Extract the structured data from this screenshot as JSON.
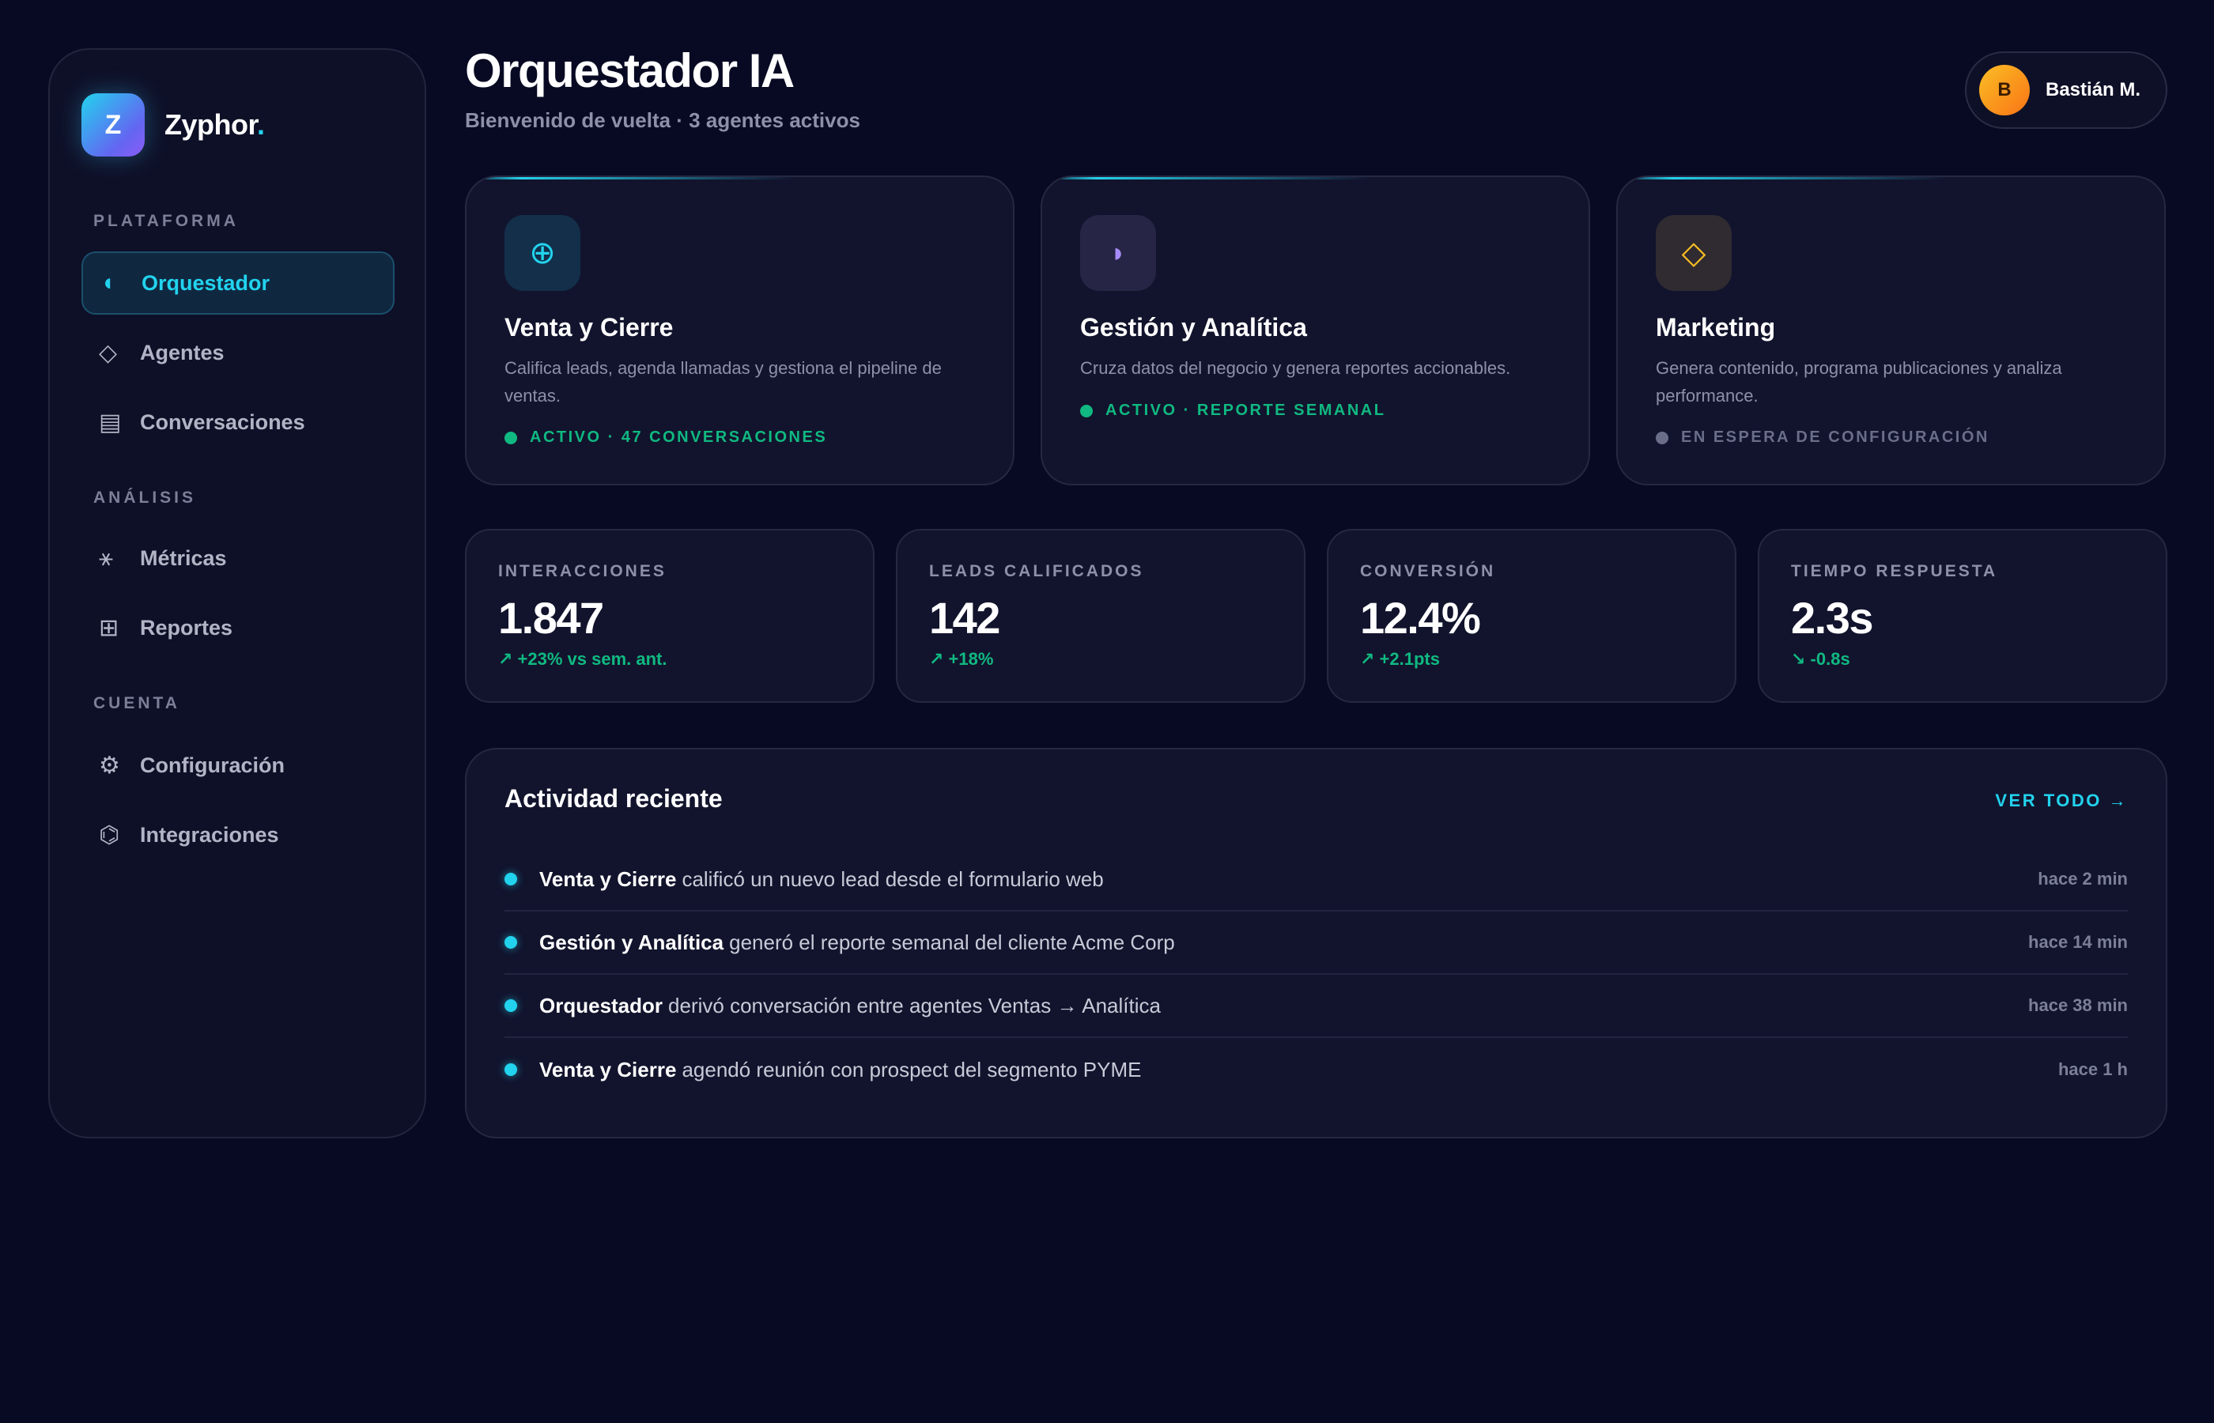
{
  "brand": {
    "initial": "Z",
    "name": "Zyphor",
    "dot": "."
  },
  "sidebar": {
    "sections": [
      {
        "label": "PLATAFORMA",
        "items": [
          {
            "icon": "orchestrator-icon",
            "glyph": "◖",
            "label": "Orquestador",
            "active": true
          },
          {
            "icon": "diamond-icon",
            "glyph": "◇",
            "label": "Agentes"
          },
          {
            "icon": "chat-icon",
            "glyph": "▤",
            "label": "Conversaciones"
          }
        ]
      },
      {
        "label": "ANÁLISIS",
        "items": [
          {
            "icon": "metrics-icon",
            "glyph": "⚹",
            "label": "Métricas"
          },
          {
            "icon": "grid-icon",
            "glyph": "⊞",
            "label": "Reportes"
          }
        ]
      },
      {
        "label": "CUENTA",
        "items": [
          {
            "icon": "gear-icon",
            "glyph": "⚙",
            "label": "Configuración"
          },
          {
            "icon": "plug-icon",
            "glyph": "⌬",
            "label": "Integraciones"
          }
        ]
      }
    ]
  },
  "header": {
    "title": "Orquestador IA",
    "subtitle": "Bienvenido de vuelta · 3 agentes activos"
  },
  "user": {
    "initial": "B",
    "name": "Bastián M."
  },
  "agents": [
    {
      "icon": "target-icon",
      "glyph": "⊕",
      "name": "Venta y Cierre",
      "description": "Califica leads, agenda llamadas y gestiona el pipeline de ventas.",
      "status": "ACTIVO · 47 CONVERSACIONES",
      "status_kind": "active"
    },
    {
      "icon": "chart-icon",
      "glyph": "◗",
      "name": "Gestión y Analítica",
      "description": "Cruza datos del negocio y genera reportes accionables.",
      "status": "ACTIVO · REPORTE SEMANAL",
      "status_kind": "active"
    },
    {
      "icon": "diamond-icon",
      "glyph": "◇",
      "name": "Marketing",
      "description": "Genera contenido, programa publicaciones y analiza performance.",
      "status": "EN ESPERA DE CONFIGURACIÓN",
      "status_kind": "waiting"
    }
  ],
  "stats": [
    {
      "label": "INTERACCIONES",
      "value": "1.847",
      "delta": "↗ +23% vs sem. ant."
    },
    {
      "label": "LEADS CALIFICADOS",
      "value": "142",
      "delta": "↗ +18%"
    },
    {
      "label": "CONVERSIÓN",
      "value": "12.4%",
      "delta": "↗ +2.1pts"
    },
    {
      "label": "TIEMPO RESPUESTA",
      "value": "2.3s",
      "delta": "↘ -0.8s"
    }
  ],
  "activity": {
    "title": "Actividad reciente",
    "view_all": "VER TODO →",
    "items": [
      {
        "agent": "Venta y Cierre",
        "text": "calificó un nuevo lead desde el formulario web",
        "time": "hace 2 min"
      },
      {
        "agent": "Gestión y Analítica",
        "text": "generó el reporte semanal del cliente Acme Corp",
        "time": "hace 14 min"
      },
      {
        "agent": "Orquestador",
        "text": "derivó conversación entre agentes Ventas → Analítica",
        "time": "hace 38 min"
      },
      {
        "agent": "Venta y Cierre",
        "text": "agendó reunión con prospect del segmento PYME",
        "time": "hace 1 h"
      }
    ]
  },
  "colors": {
    "accent": "#22d3ee",
    "success": "#10b981",
    "muted": "#6b6e88",
    "background": "#080a23",
    "card": "#12142d"
  }
}
